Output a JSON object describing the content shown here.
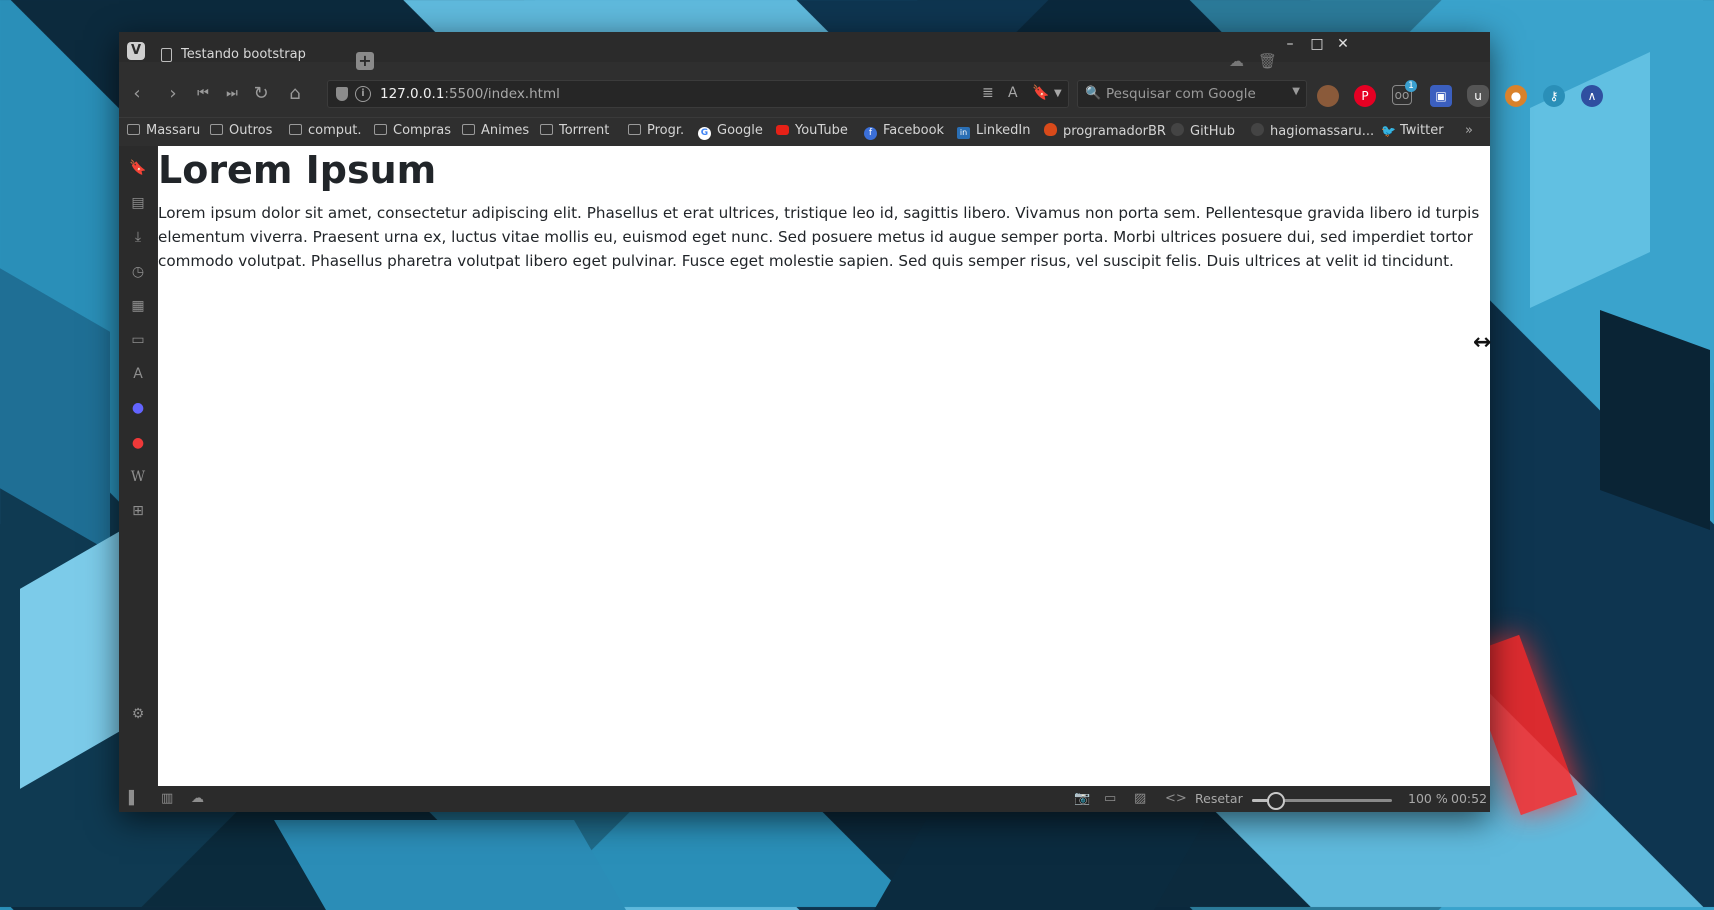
{
  "window": {
    "tab_title": "Testando bootstrap",
    "new_tab_icon": "plus-icon",
    "controls": [
      "minimize",
      "maximize",
      "close"
    ]
  },
  "toolbar": {
    "url_host": "127.0.0.1",
    "url_rest": ":5500/index.html",
    "search_placeholder": "Pesquisar com Google",
    "extension_badge": "1"
  },
  "bookmarks": [
    {
      "label": "Massaru",
      "icon": "bookmark-icon"
    },
    {
      "label": "Outros",
      "icon": "folder-icon"
    },
    {
      "label": "comput.",
      "icon": "folder-icon"
    },
    {
      "label": "Compras",
      "icon": "folder-icon"
    },
    {
      "label": "Animes",
      "icon": "folder-icon"
    },
    {
      "label": "Torrrent",
      "icon": "folder-icon"
    },
    {
      "label": "Progr.",
      "icon": "folder-icon"
    },
    {
      "label": "Google",
      "icon": "google-icon"
    },
    {
      "label": "YouTube",
      "icon": "youtube-icon"
    },
    {
      "label": "Facebook",
      "icon": "facebook-icon"
    },
    {
      "label": "LinkedIn",
      "icon": "linkedin-icon"
    },
    {
      "label": "programadorBR",
      "icon": "fire-icon"
    },
    {
      "label": "GitHub",
      "icon": "github-icon"
    },
    {
      "label": "hagiomassaru...",
      "icon": "github-icon"
    },
    {
      "label": "Twitter",
      "icon": "twitter-icon"
    }
  ],
  "page": {
    "heading": "Lorem Ipsum",
    "paragraph": "Lorem ipsum dolor sit amet, consectetur adipiscing elit. Phasellus et erat ultrices, tristique leo id, sagittis libero. Vivamus non porta sem. Pellentesque gravida libero id turpis elementum viverra. Praesent urna ex, luctus vitae mollis eu, euismod eget nunc. Sed posuere metus id augue semper porta. Morbi ultrices posuere dui, sed imperdiet tortor commodo volutpat. Phasellus pharetra volutpat libero eget pulvinar. Fusce eget molestie sapien. Sed quis semper risus, vel suscipit felis. Duis ultrices at velit id tincidunt."
  },
  "statusbar": {
    "reset_label": "Resetar",
    "zoom": "100 %",
    "zoom_fraction": 0.17,
    "clock": "00:52"
  }
}
